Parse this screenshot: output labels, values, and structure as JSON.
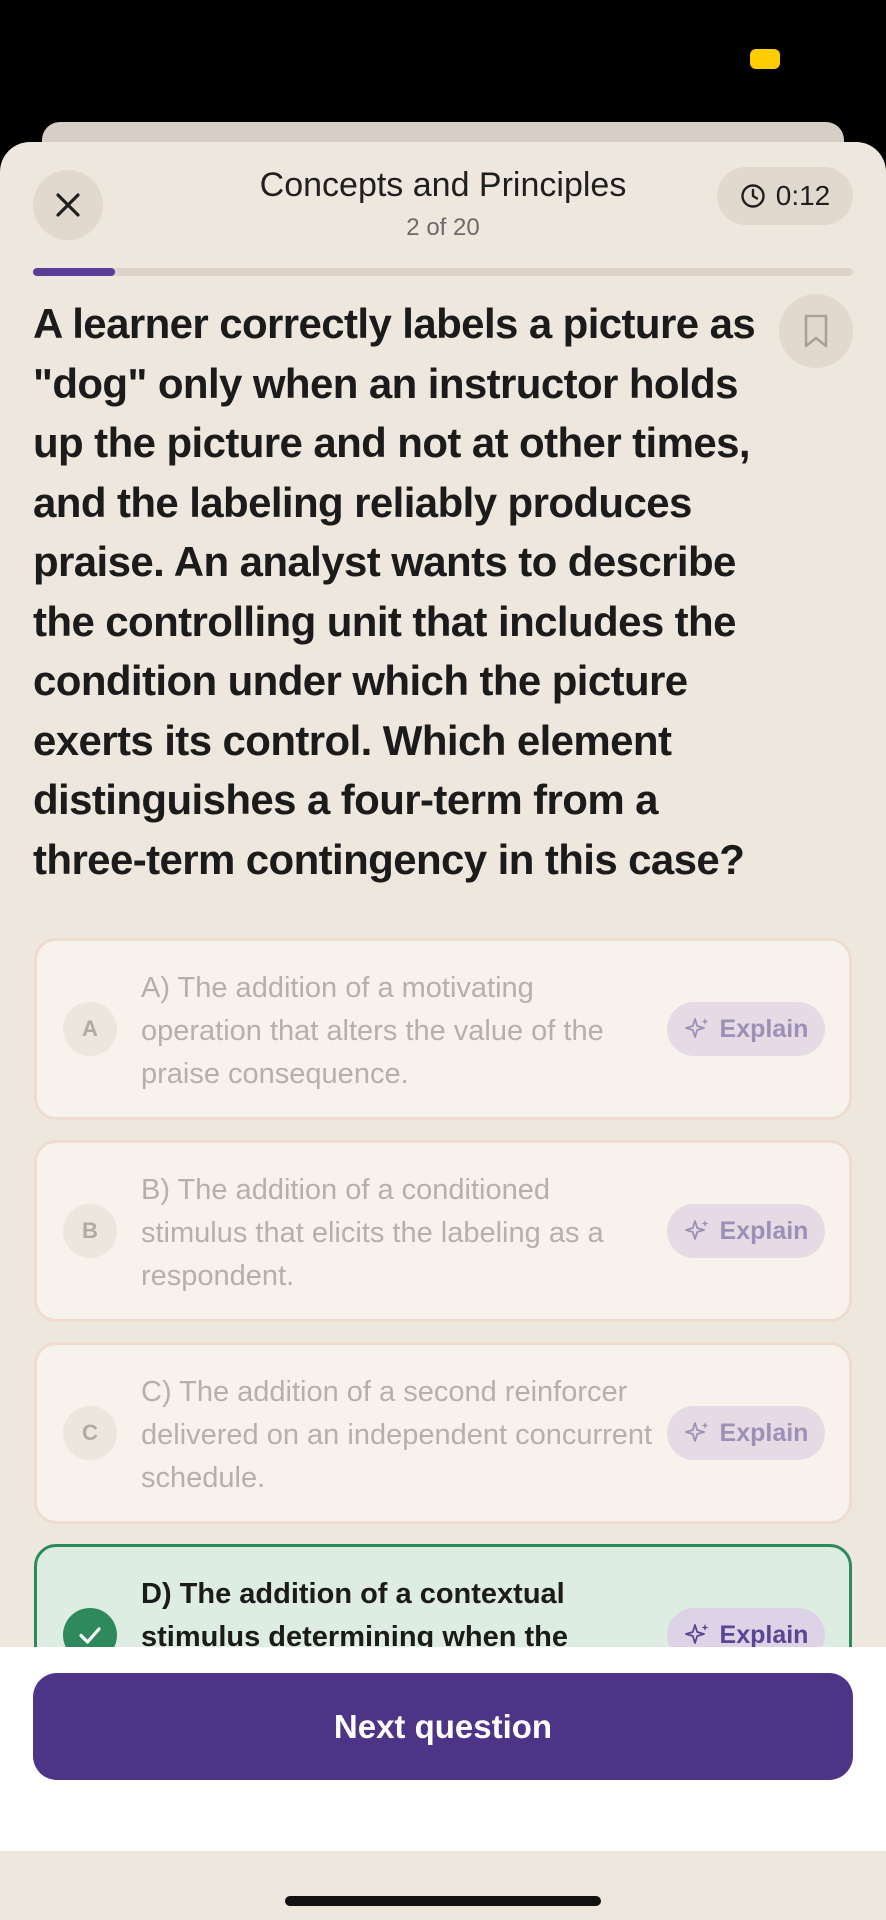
{
  "header": {
    "title": "Concepts and Principles",
    "subtitle": "2 of 20",
    "timer": "0:12",
    "progress_fraction": 0.1
  },
  "question": {
    "text": "A learner correctly labels a picture as \"dog\" only when an instructor holds up the picture and not at other times, and the labeling reliably produces praise. An analyst wants to describe the controlling unit that includes the condition under which the picture exerts its control. Which element distinguishes a four-term from a three-term contingency in this case?"
  },
  "options": [
    {
      "letter": "A",
      "text": "A) The addition of a motivating operation that alters the value of the praise consequence.",
      "explain_label": "Explain",
      "state": "disabled"
    },
    {
      "letter": "B",
      "text": "B) The addition of a conditioned stimulus that elicits the labeling as a respondent.",
      "explain_label": "Explain",
      "state": "disabled"
    },
    {
      "letter": "C",
      "text": "C) The addition of a second reinforcer delivered on an independent concurrent schedule.",
      "explain_label": "Explain",
      "state": "disabled"
    },
    {
      "letter": "D",
      "text": "D) The addition of a contextual stimulus determining when the",
      "explain_label": "Explain",
      "state": "correct"
    }
  ],
  "footer": {
    "next_label": "Next question"
  },
  "colors": {
    "accent": "#4E3487",
    "correct": "#2E8A5C",
    "background": "#EEE7DD"
  },
  "icons": {
    "close": "close-icon",
    "timer": "clock-icon",
    "bookmark": "bookmark-icon",
    "explain": "sparkle-icon",
    "correct": "check-icon"
  }
}
